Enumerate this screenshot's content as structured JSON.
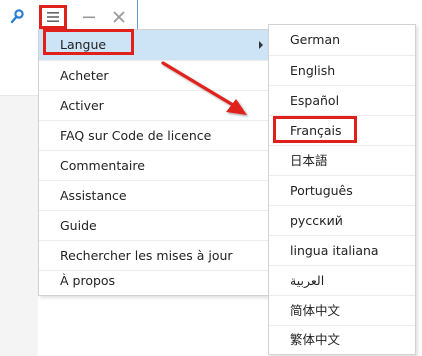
{
  "titlebar": {
    "key_icon": "key-icon",
    "menu_icon": "hamburger-menu-icon",
    "minimize_icon": "minimize-icon",
    "close_icon": "close-icon"
  },
  "main_menu": {
    "items": [
      {
        "label": "Langue",
        "has_submenu": true,
        "active": true
      },
      {
        "label": "Acheter"
      },
      {
        "label": "Activer"
      },
      {
        "label": "FAQ sur Code de licence"
      },
      {
        "label": "Commentaire"
      },
      {
        "label": "Assistance"
      },
      {
        "label": "Guide"
      },
      {
        "label": "Rechercher les mises à jour"
      },
      {
        "label": "À propos"
      }
    ]
  },
  "language_menu": {
    "items": [
      {
        "label": "German"
      },
      {
        "label": "English"
      },
      {
        "label": "Español"
      },
      {
        "label": "Français",
        "highlighted": true
      },
      {
        "label": "日本語"
      },
      {
        "label": "Português"
      },
      {
        "label": "русский"
      },
      {
        "label": "lingua italiana"
      },
      {
        "label": "العربية"
      },
      {
        "label": "简体中文"
      },
      {
        "label": "繁体中文"
      }
    ]
  },
  "colors": {
    "highlight_red": "#e0201a",
    "active_item_bg": "#cde4f7",
    "window_border_blue": "#5a9bd6"
  }
}
